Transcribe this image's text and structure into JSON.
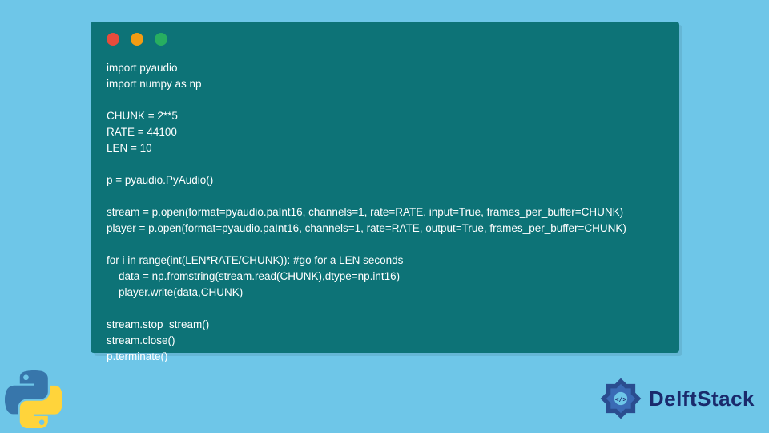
{
  "code": {
    "lines": [
      "import pyaudio",
      "import numpy as np",
      "",
      "CHUNK = 2**5",
      "RATE = 44100",
      "LEN = 10",
      "",
      "p = pyaudio.PyAudio()",
      "",
      "stream = p.open(format=pyaudio.paInt16, channels=1, rate=RATE, input=True, frames_per_buffer=CHUNK)",
      "player = p.open(format=pyaudio.paInt16, channels=1, rate=RATE, output=True, frames_per_buffer=CHUNK)",
      "",
      "for i in range(int(LEN*RATE/CHUNK)): #go for a LEN seconds",
      "    data = np.fromstring(stream.read(CHUNK),dtype=np.int16)",
      "    player.write(data,CHUNK)",
      "",
      "stream.stop_stream()",
      "stream.close()",
      "p.terminate()"
    ]
  },
  "brand": {
    "name": "DelftStack"
  }
}
